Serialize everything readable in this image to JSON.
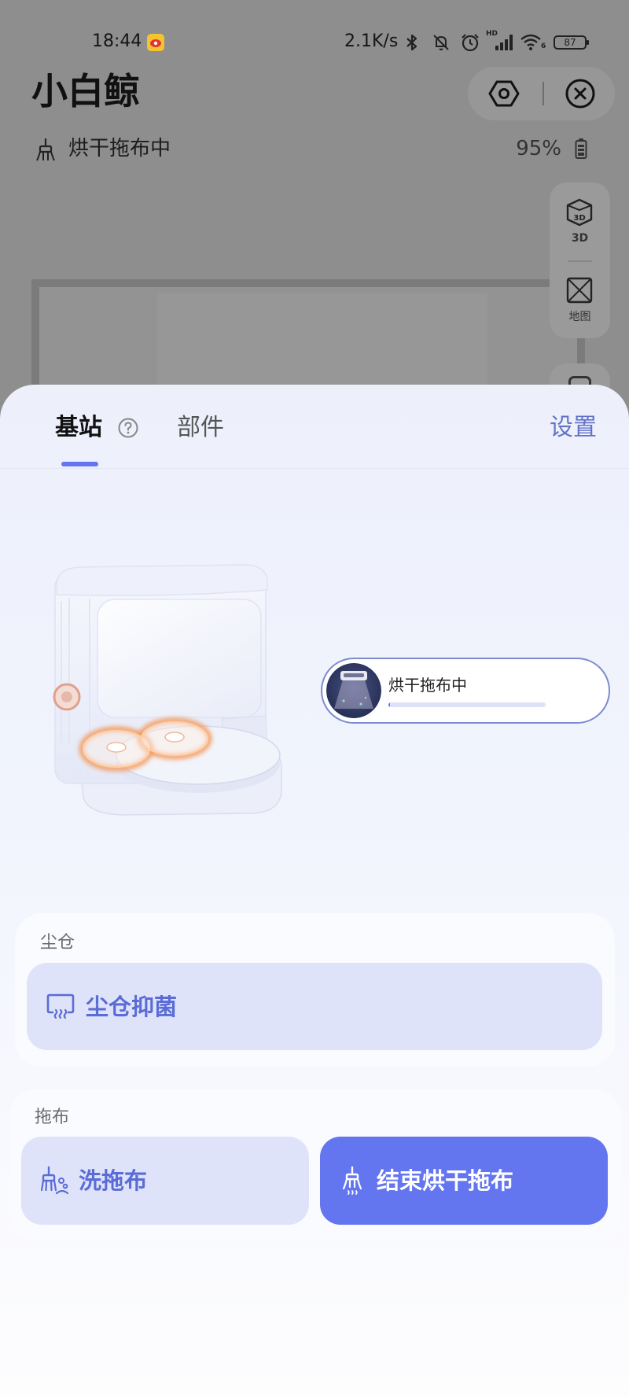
{
  "status_bar": {
    "time": "18:44",
    "net_speed": "2.1K/s",
    "signal_badge": "HD",
    "wifi_badge": "6",
    "battery_level": "87",
    "icons": [
      "weibo-icon",
      "bluetooth-icon",
      "bell-off-icon",
      "alarm-icon",
      "signal-icon",
      "wifi-icon",
      "battery-icon"
    ]
  },
  "header": {
    "title": "小白鲸",
    "status_text": "烘干拖布中",
    "battery_percent": "95%",
    "icons": {
      "status": "mop-brush-icon",
      "battery": "battery-icon",
      "settings": "hexagon-settings-icon",
      "close": "close-icon"
    }
  },
  "map_controls": {
    "view_3d_label": "3D",
    "map_label": "地图",
    "icons": {
      "view_3d": "cube-3d-icon",
      "map": "map-icon"
    }
  },
  "sheet": {
    "tabs": [
      {
        "label": "基站",
        "active": true
      },
      {
        "label": "部件",
        "active": false
      }
    ],
    "settings_label": "设置",
    "help_icon": "help-circle-icon"
  },
  "station": {
    "status_label": "烘干拖布中",
    "progress_percent": 1
  },
  "dust_bin": {
    "section_label": "尘仓",
    "sterilize_button": {
      "label": "尘仓抑菌",
      "icon": "dust-bin-sterilize-icon"
    }
  },
  "mop": {
    "section_label": "拖布",
    "wash_button": {
      "label": "洗拖布",
      "icon": "wash-mop-icon"
    },
    "stop_drying_button": {
      "label": "结束烘干拖布",
      "icon": "mop-drying-icon"
    }
  },
  "colors": {
    "accent": "#6476EF",
    "accent_text": "#5A6CD6",
    "soft_button": "#DFE3FA",
    "settings_link": "#6273C9"
  }
}
